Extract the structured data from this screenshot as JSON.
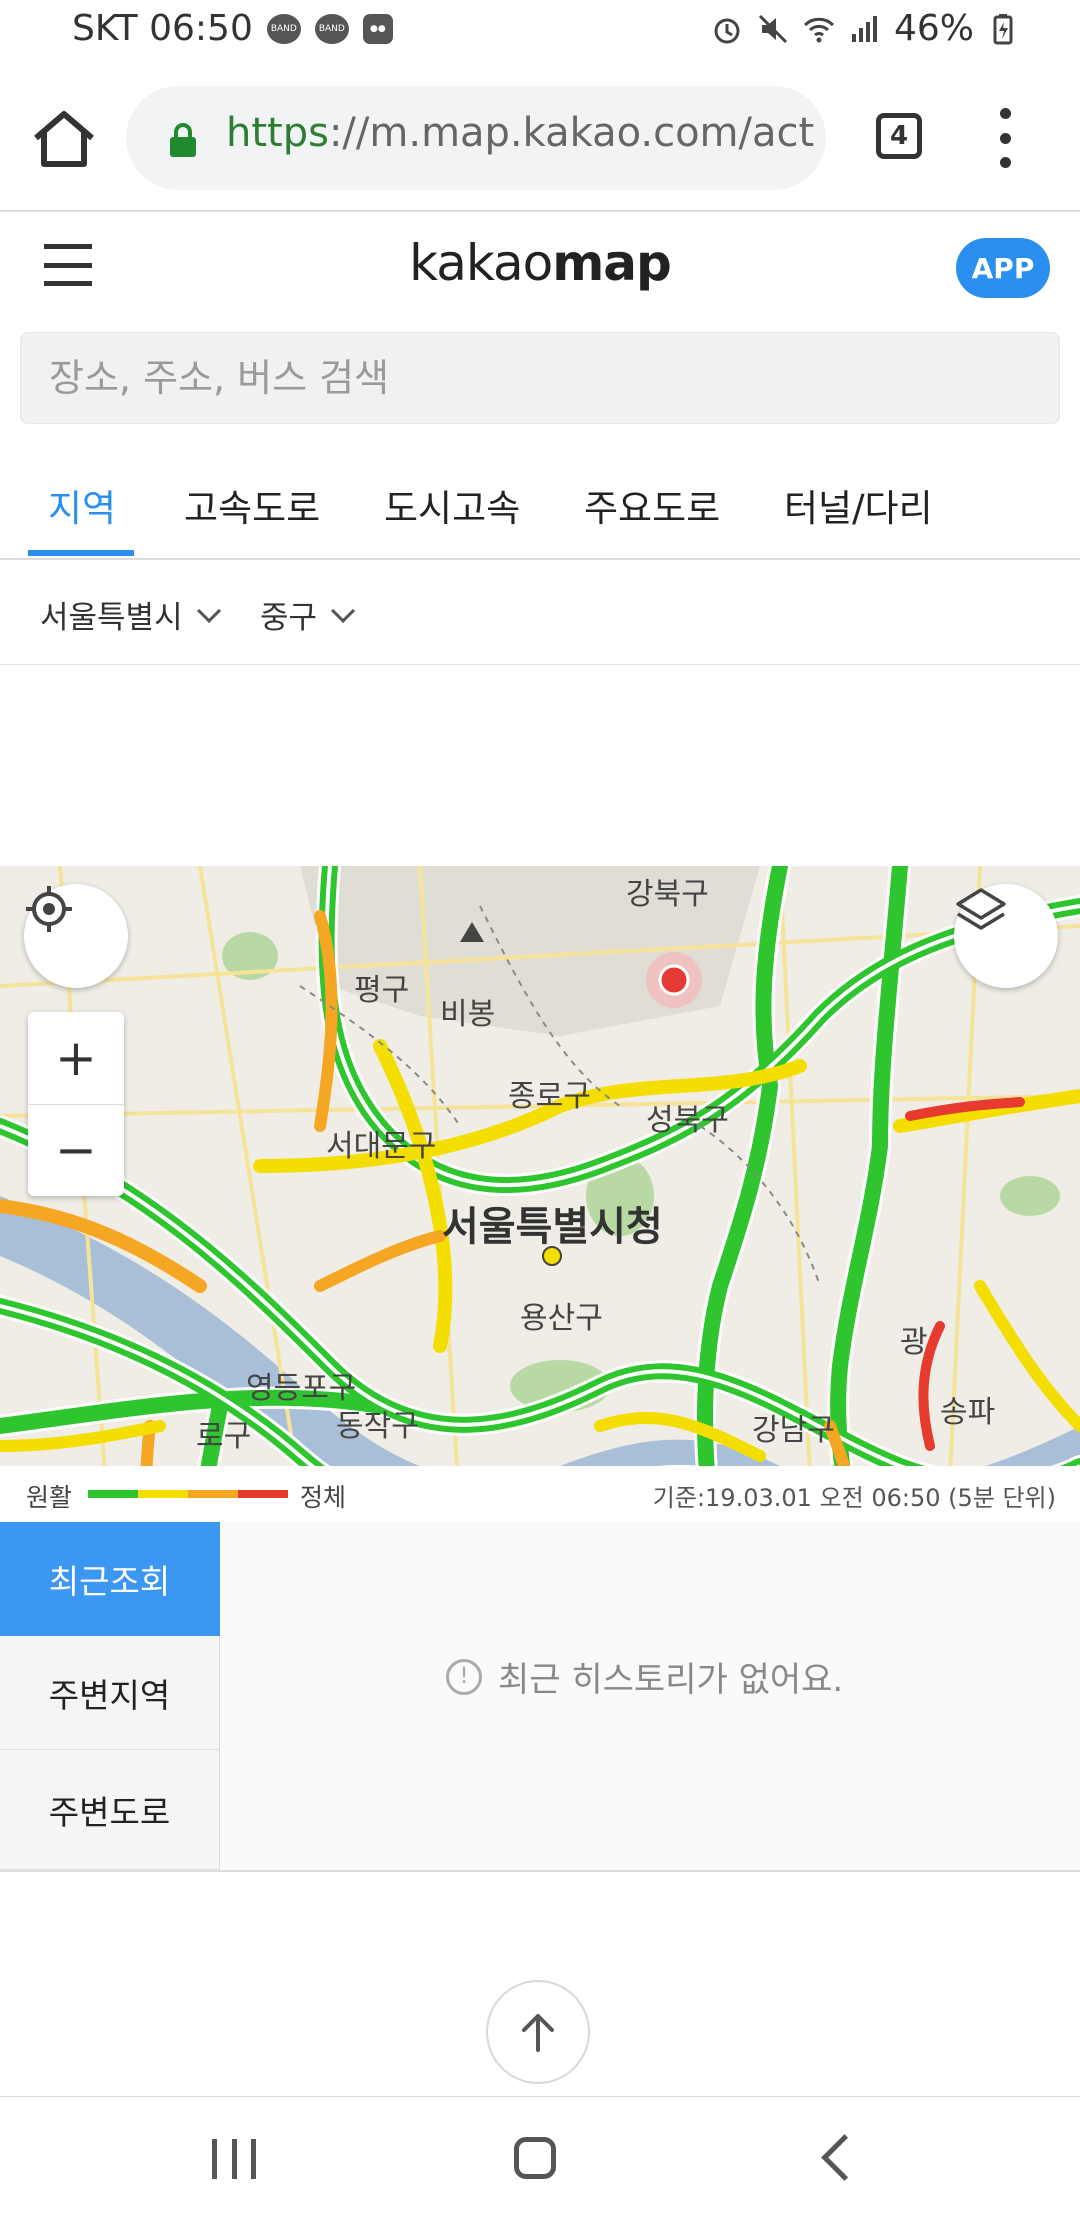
{
  "status_bar": {
    "carrier_time": "SKT 06:50",
    "notif_1": "BAND",
    "notif_2": "BAND",
    "battery": "46%"
  },
  "browser": {
    "url_scheme": "https",
    "url_rest": "://m.map.kakao.com/acti",
    "tab_count": "4"
  },
  "header": {
    "logo_light": "kakao",
    "logo_bold": "map",
    "app_button": "APP"
  },
  "search": {
    "placeholder": "장소, 주소, 버스 검색",
    "value": ""
  },
  "tabs": [
    {
      "label": "지역",
      "active": true
    },
    {
      "label": "고속도로"
    },
    {
      "label": "도시고속"
    },
    {
      "label": "주요도로"
    },
    {
      "label": "터널/다리"
    }
  ],
  "filters": {
    "city": "서울특별시",
    "district": "중구"
  },
  "map": {
    "labels": [
      "강북구",
      "평구",
      "비봉",
      "종로구",
      "성북구",
      "서대문구",
      "서울특별시청",
      "용산구",
      "영등포구",
      "동작구",
      "강남구",
      "송파",
      "광명",
      "광",
      "로구"
    ],
    "zoom_in": "+",
    "zoom_out": "−"
  },
  "legend": {
    "smooth": "원활",
    "congested": "정체",
    "timestamp": "기준:19.03.01 오전 06:50 (5분 단위)"
  },
  "history": {
    "side_tabs": [
      {
        "label": "최근조회",
        "active": true
      },
      {
        "label": "주변지역"
      },
      {
        "label": "주변도로"
      }
    ],
    "empty_message": "최근 히스토리가 없어요."
  },
  "colors": {
    "accent": "#2a8ff0",
    "traffic_smooth": "#2ec52e",
    "traffic_slow": "#f3de00",
    "traffic_delay": "#f5a623",
    "traffic_jam": "#e63b2e"
  },
  "icons": [
    "home-icon",
    "lock-icon",
    "menu-icon",
    "locate-icon",
    "layers-icon",
    "arrow-up-icon",
    "recent-apps-icon",
    "home-nav-icon",
    "back-icon"
  ]
}
